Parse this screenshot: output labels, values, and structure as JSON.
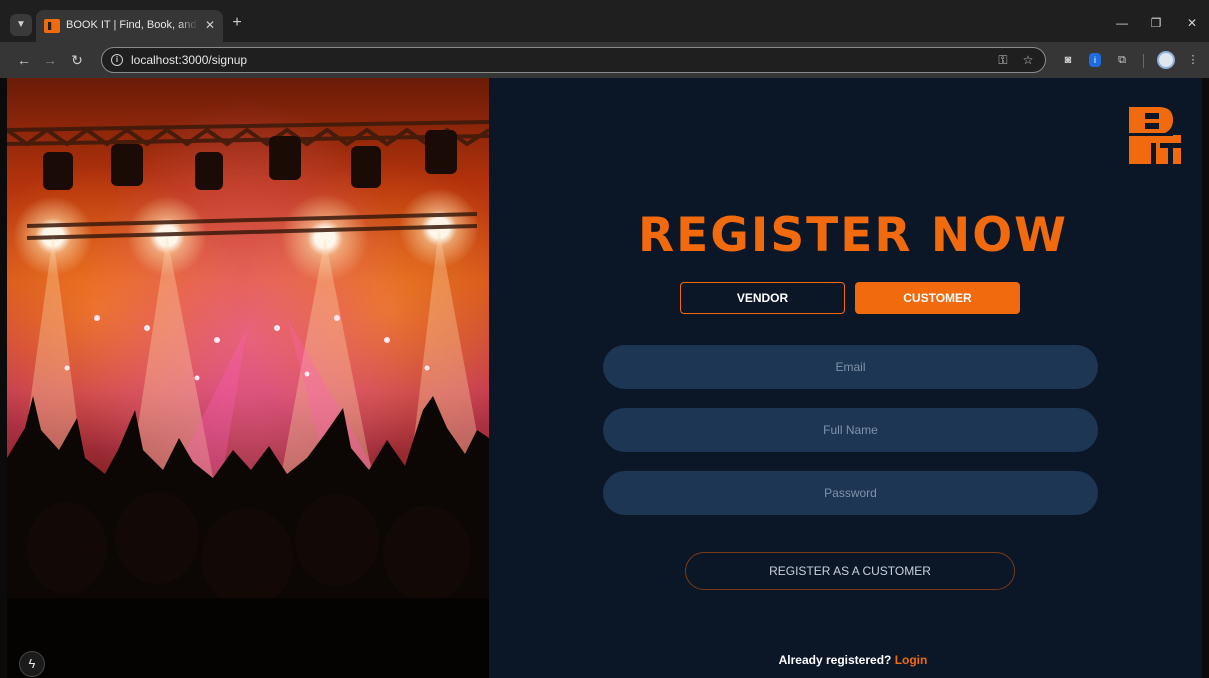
{
  "browser": {
    "tab_title": "BOOK IT | Find, Book, and Enjoy",
    "tab_close": "✕",
    "new_tab": "+",
    "url": "localhost:3000/signup",
    "window_controls": {
      "minimize": "—",
      "restore": "❐",
      "close": "✕"
    }
  },
  "page": {
    "heading": "REGISTER NOW",
    "roles": {
      "vendor": "VENDOR",
      "customer": "CUSTOMER",
      "selected": "CUSTOMER"
    },
    "fields": {
      "email_placeholder": "Email",
      "fullname_placeholder": "Full Name",
      "password_placeholder": "Password"
    },
    "submit_label": "REGISTER AS A CUSTOMER",
    "already_text": "Already registered? ",
    "login_label": "Login"
  },
  "colors": {
    "accent": "#f26a0e",
    "panel": "#0b1727",
    "field": "#1d3654"
  },
  "icons": {
    "tab_menu": "chevron-down-icon",
    "back": "back-arrow-icon",
    "forward": "forward-arrow-icon",
    "reload": "reload-icon",
    "site_info": "info-icon",
    "password_key": "key-icon",
    "bookmark": "star-icon",
    "camera": "camera-icon",
    "extension": "puzzle-icon",
    "menu": "kebab-menu-icon",
    "assistant": "lightning-icon"
  }
}
